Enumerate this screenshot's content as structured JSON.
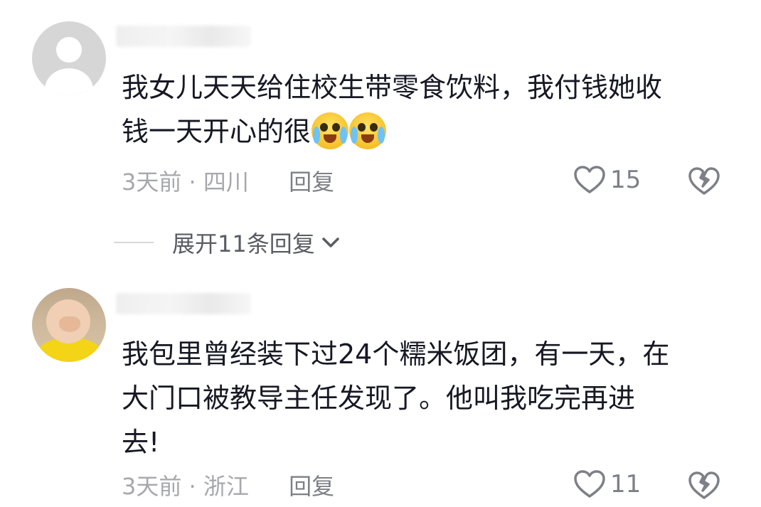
{
  "comments": [
    {
      "username": "",
      "text_line1": "我女儿天天给住校生带零食饮料，我付钱她收",
      "text_line2": "钱一天开心的很",
      "emojis": [
        "crying-laughing-emoji",
        "crying-laughing-emoji"
      ],
      "time": "3天前",
      "location": "四川",
      "reply_label": "回复",
      "likes": "15"
    },
    {
      "username": "",
      "text_line1": "我包里曾经装下过24个糯米饭团，有一天，在",
      "text_line2": "大门口被教导主任发现了。他叫我吃完再进",
      "text_line3": "去!",
      "time": "3天前",
      "location": "浙江",
      "reply_label": "回复",
      "likes": "11"
    }
  ],
  "expand_replies": {
    "label": "展开11条回复"
  },
  "separator": "·",
  "colors": {
    "text": "#161823",
    "meta": "#a7a8ab",
    "icon": "#7e8087"
  }
}
